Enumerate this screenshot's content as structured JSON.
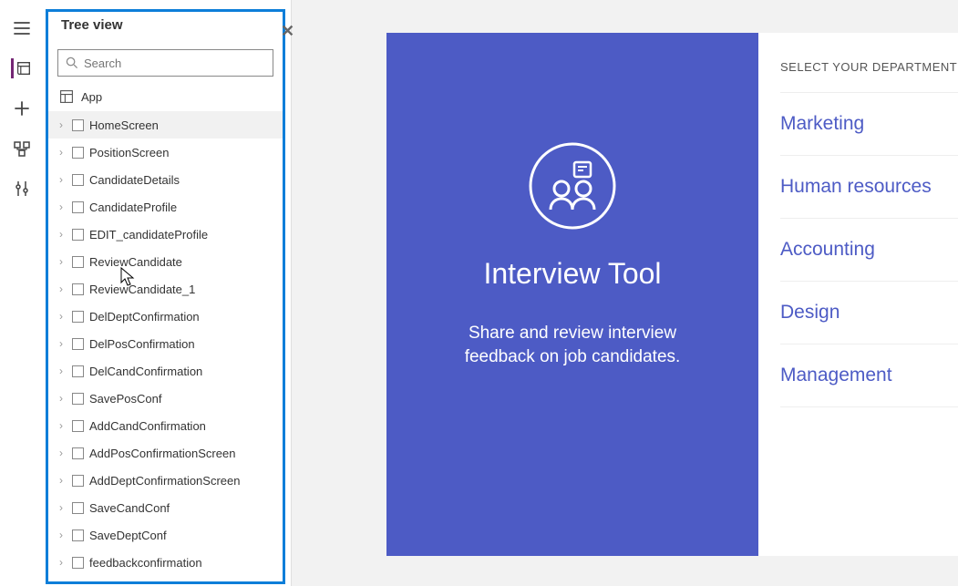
{
  "treeview": {
    "title": "Tree view",
    "searchPlaceholder": "Search",
    "app_label": "App",
    "items": [
      {
        "label": "HomeScreen",
        "selected": true,
        "dots": true
      },
      {
        "label": "PositionScreen"
      },
      {
        "label": "CandidateDetails"
      },
      {
        "label": "CandidateProfile"
      },
      {
        "label": "EDIT_candidateProfile"
      },
      {
        "label": "ReviewCandidate",
        "dots": true
      },
      {
        "label": "ReviewCandidate_1"
      },
      {
        "label": "DelDeptConfirmation"
      },
      {
        "label": "DelPosConfirmation"
      },
      {
        "label": "DelCandConfirmation"
      },
      {
        "label": "SavePosConf"
      },
      {
        "label": "AddCandConfirmation"
      },
      {
        "label": "AddPosConfirmationScreen"
      },
      {
        "label": "AddDeptConfirmationScreen"
      },
      {
        "label": "SaveCandConf"
      },
      {
        "label": "SaveDeptConf"
      },
      {
        "label": "feedbackconfirmation"
      }
    ]
  },
  "preview": {
    "title": "Interview Tool",
    "description": "Share and review interview feedback on job candidates.",
    "department_header": "SELECT YOUR DEPARTMENT",
    "departments": [
      {
        "name": "Marketing"
      },
      {
        "name": "Human resources"
      },
      {
        "name": "Accounting"
      },
      {
        "name": "Design"
      },
      {
        "name": "Management"
      }
    ]
  }
}
